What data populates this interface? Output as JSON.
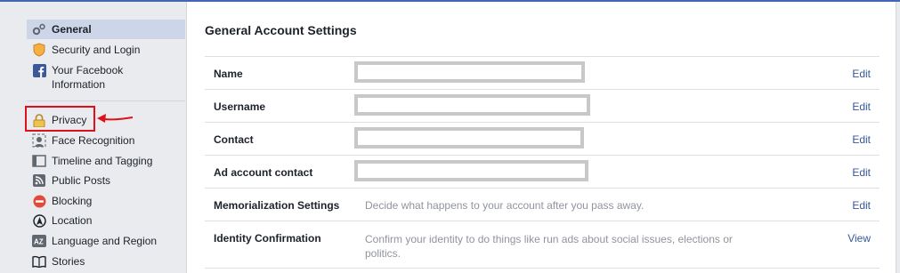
{
  "sidebar": {
    "items": [
      {
        "label": "General",
        "icon": "gears-icon"
      },
      {
        "label": "Security and Login",
        "icon": "shield-icon"
      },
      {
        "label": "Your Facebook Information",
        "icon": "facebook-icon"
      },
      {
        "label": "Privacy",
        "icon": "lock-icon"
      },
      {
        "label": "Face Recognition",
        "icon": "face-icon"
      },
      {
        "label": "Timeline and Tagging",
        "icon": "timeline-icon"
      },
      {
        "label": "Public Posts",
        "icon": "rss-icon"
      },
      {
        "label": "Blocking",
        "icon": "block-icon"
      },
      {
        "label": "Location",
        "icon": "location-icon"
      },
      {
        "label": "Language and Region",
        "icon": "language-icon"
      },
      {
        "label": "Stories",
        "icon": "book-icon"
      }
    ]
  },
  "main": {
    "title": "General Account Settings",
    "rows": [
      {
        "label": "Name",
        "value": "",
        "action": "Edit"
      },
      {
        "label": "Username",
        "value": "",
        "action": "Edit"
      },
      {
        "label": "Contact",
        "value": "",
        "action": "Edit"
      },
      {
        "label": "Ad account contact",
        "value": "",
        "action": "Edit"
      },
      {
        "label": "Memorialization Settings",
        "value": "Decide what happens to your account after you pass away.",
        "action": "Edit"
      },
      {
        "label": "Identity Confirmation",
        "value": "Confirm your identity to do things like run ads about social issues, elections or politics.",
        "action": "View"
      }
    ]
  },
  "colors": {
    "accent": "#4267b2",
    "link": "#365899",
    "highlight": "#e0101a"
  }
}
